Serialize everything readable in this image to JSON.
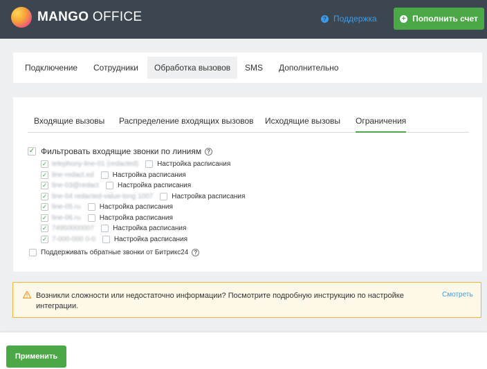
{
  "header": {
    "logo_bold": "MANGO",
    "logo_light": "OFFICE",
    "support_label": "Поддержка",
    "topup_label": "Пополнить счет"
  },
  "main_tabs": [
    {
      "label": "Подключение",
      "active": false
    },
    {
      "label": "Сотрудники",
      "active": false
    },
    {
      "label": "Обработка вызовов",
      "active": true
    },
    {
      "label": "SMS",
      "active": false
    },
    {
      "label": "Дополнительно",
      "active": false
    }
  ],
  "sub_tabs": [
    {
      "label": "Входящие вызовы",
      "active": false
    },
    {
      "label": "Распределение входящих вызовов",
      "active": false
    },
    {
      "label": "Исходящие вызовы",
      "active": false
    },
    {
      "label": "Ограничения",
      "active": true
    }
  ],
  "filter": {
    "label": "Фильтровать входящие звонки по линиям",
    "checked": true
  },
  "lines": [
    {
      "masked": "telephony-line-01 (redacted)",
      "checked": true,
      "schedule_label": "Настройка расписания"
    },
    {
      "masked": "line-redact.ed",
      "checked": true,
      "schedule_label": "Настройка расписания"
    },
    {
      "masked": "line-03@redact",
      "checked": true,
      "schedule_label": "Настройка расписания"
    },
    {
      "masked": "line-04 redacted-value-long 1007",
      "checked": true,
      "schedule_label": "Настройка расписания"
    },
    {
      "masked": "line-05.ru",
      "checked": true,
      "schedule_label": "Настройка расписания"
    },
    {
      "masked": "line-06.ru",
      "checked": true,
      "schedule_label": "Настройка расписания"
    },
    {
      "masked": "74950000007",
      "checked": true,
      "schedule_label": "Настройка расписания"
    },
    {
      "masked": "7-000-000 0-0",
      "checked": true,
      "schedule_label": "Настройка расписания"
    }
  ],
  "bitrix": {
    "label": "Поддерживать обратные звонки от Битрикс24",
    "checked": false
  },
  "alert": {
    "message": "Возникли сложности или недостаточно информации? Посмотрите подробную инструкцию по настройке интеграции.",
    "link_label": "Смотреть"
  },
  "footer": {
    "apply_label": "Применить"
  },
  "colors": {
    "topbar": "#3c4650",
    "accent_green": "#4aa847",
    "link_blue": "#3d9be9",
    "alert_border": "#f3b23b"
  }
}
